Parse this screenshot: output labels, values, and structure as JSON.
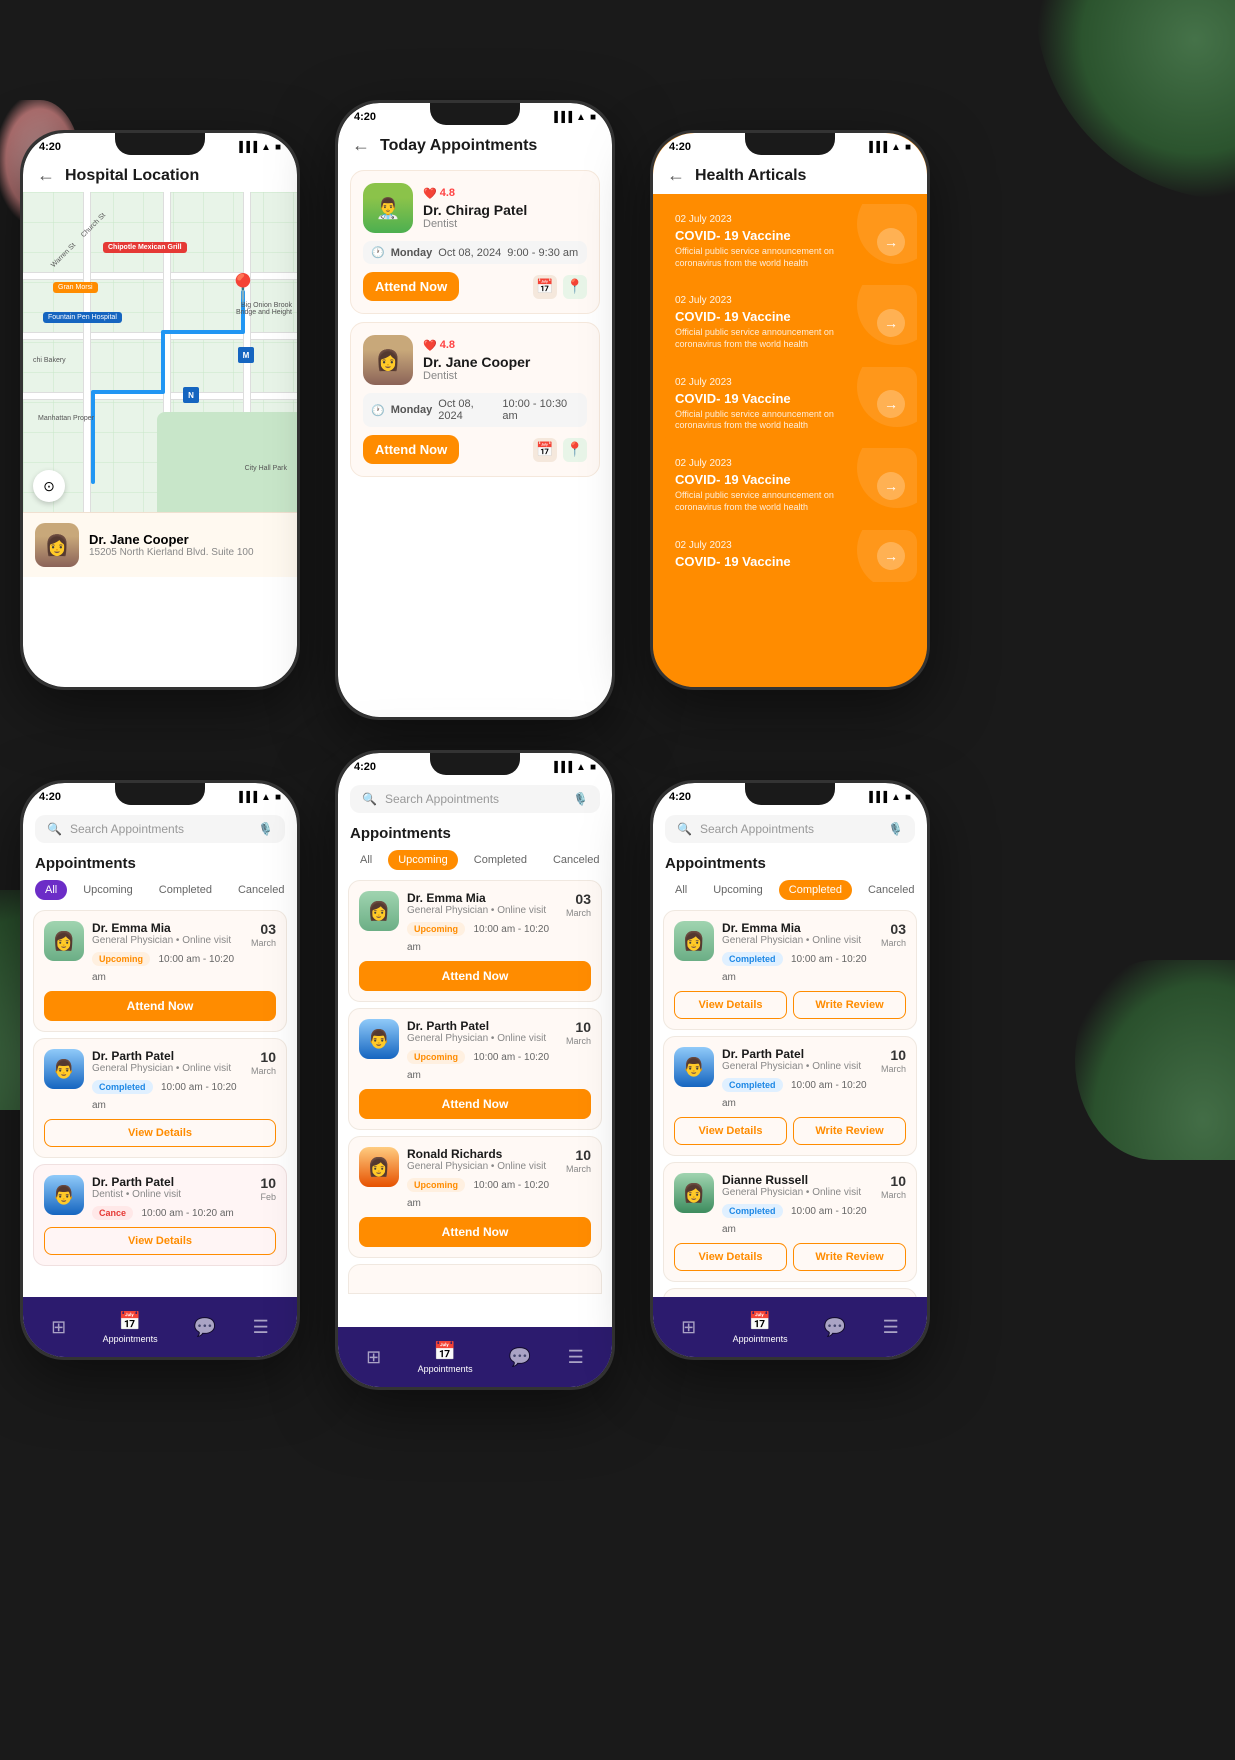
{
  "app": {
    "status_time": "4:20",
    "status_icons": "▐▐▐ ▲ ■"
  },
  "phone1": {
    "title": "Hospital Location",
    "doctor_name": "Dr. Jane Cooper",
    "doctor_address": "15205 North Kierland Blvd. Suite 100",
    "map_labels": {
      "chipotle": "Chipotle Mexican Grill",
      "gran_morsi": "Gran Morsi",
      "fountain": "Fountain Pen Hospital",
      "bakery": "chi Bakery",
      "big_onion": "Big Onion Brook Bridge and Height",
      "manhattan": "Manhattan Proper",
      "city_hall": "City Hall Park",
      "warren": "Warren St",
      "church": "Church St"
    }
  },
  "phone2": {
    "title": "Today Appointments",
    "appointments": [
      {
        "doctor": "Dr. Chirag Patel",
        "specialty": "Dentist",
        "rating": "4.8",
        "day": "Monday",
        "date": "Oct 08, 2024",
        "time": "9:00 - 9:30 am",
        "action": "Attend Now"
      },
      {
        "doctor": "Dr. Jane Cooper",
        "specialty": "Dentist",
        "rating": "4.8",
        "day": "Monday",
        "date": "Oct 08, 2024",
        "time": "10:00 - 10:30 am",
        "action": "Attend Now"
      }
    ]
  },
  "phone3": {
    "title": "Health Articals",
    "articles": [
      {
        "date": "02 July 2023",
        "title": "COVID- 19 Vaccine",
        "desc": "Official public service announcement on coronavirus from the world health"
      },
      {
        "date": "02 July 2023",
        "title": "COVID- 19 Vaccine",
        "desc": "Official public service announcement on coronavirus from the world health"
      },
      {
        "date": "02 July 2023",
        "title": "COVID- 19 Vaccine",
        "desc": "Official public service announcement on coronavirus from the world health"
      },
      {
        "date": "02 July 2023",
        "title": "COVID- 19 Vaccine",
        "desc": "Official public service announcement on coronavirus from the world health"
      },
      {
        "date": "02 July 2023",
        "title": "COVID- 19 Vaccine",
        "desc": ""
      }
    ]
  },
  "phone4": {
    "search_placeholder": "Search Appointments",
    "section_title": "Appointments",
    "filters": [
      "All",
      "Upcoming",
      "Completed",
      "Canceled"
    ],
    "active_filter": "All",
    "appointments": [
      {
        "doctor": "Dr. Emma Mia",
        "spec": "General Physician • Online visit",
        "status": "Upcoming",
        "status_class": "upcoming",
        "time": "10:00 am - 10:20 am",
        "date_num": "03",
        "date_month": "March",
        "action": "Attend Now",
        "action_type": "primary"
      },
      {
        "doctor": "Dr. Parth Patel",
        "spec": "General Physician • Online visit",
        "status": "Completed",
        "status_class": "completed",
        "time": "10:00 am - 10:20 am",
        "date_num": "10",
        "date_month": "March",
        "action": "View Details",
        "action_type": "outline"
      },
      {
        "doctor": "Dr. Parth Patel",
        "spec": "Dentist • Online visit",
        "status": "Cance",
        "status_class": "cancelled",
        "time": "10:00 am - 10:20 am",
        "date_num": "10",
        "date_month": "Feb",
        "action": "View Details",
        "action_type": "outline"
      }
    ],
    "nav": [
      "🏠",
      "Appointments",
      "💬",
      "☰"
    ],
    "nav_labels": [
      "",
      "Appointments",
      "",
      ""
    ]
  },
  "phone5": {
    "search_placeholder": "Search Appointments",
    "section_title": "Appointments",
    "filters": [
      "All",
      "Upcoming",
      "Completed",
      "Canceled"
    ],
    "active_filter": "Upcoming",
    "appointments": [
      {
        "doctor": "Dr. Emma Mia",
        "spec": "General Physician • Online visit",
        "status": "Upcoming",
        "status_class": "upcoming",
        "time": "10:00 am - 10:20 am",
        "date_num": "03",
        "date_month": "March",
        "action": "Attend Now",
        "action_type": "primary"
      },
      {
        "doctor": "Dr. Parth Patel",
        "spec": "General Physician • Online visit",
        "status": "Upcoming",
        "status_class": "upcoming",
        "time": "10:00 am - 10:20 am",
        "date_num": "10",
        "date_month": "March",
        "action": "Attend Now",
        "action_type": "primary"
      },
      {
        "doctor": "Ronald Richards",
        "spec": "General Physician • Online visit",
        "status": "Upcoming",
        "status_class": "upcoming",
        "time": "10:00 am - 10:20 am",
        "date_num": "10",
        "date_month": "March",
        "action": "Attend Now",
        "action_type": "primary"
      }
    ]
  },
  "phone6": {
    "search_placeholder": "Search Appointments",
    "section_title": "Appointments",
    "filters": [
      "All",
      "Upcoming",
      "Completed",
      "Canceled"
    ],
    "active_filter": "Completed",
    "appointments": [
      {
        "doctor": "Dr. Emma Mia",
        "spec": "General Physician • Online visit",
        "status": "Completed",
        "status_class": "completed",
        "time": "10:00 am - 10:20 am",
        "date_num": "03",
        "date_month": "March",
        "action1": "View Details",
        "action2": "Write Review"
      },
      {
        "doctor": "Dr. Parth Patel",
        "spec": "General Physician • Online visit",
        "status": "Completed",
        "status_class": "completed",
        "time": "10:00 am - 10:20 am",
        "date_num": "10",
        "date_month": "March",
        "action1": "View Details",
        "action2": "Write Review"
      },
      {
        "doctor": "Dianne Russell",
        "spec": "General Physician • Online visit",
        "status": "Completed",
        "status_class": "completed",
        "time": "10:00 am - 10:20 am",
        "date_num": "10",
        "date_month": "March",
        "action1": "View Details",
        "action2": "Write Review"
      }
    ]
  }
}
